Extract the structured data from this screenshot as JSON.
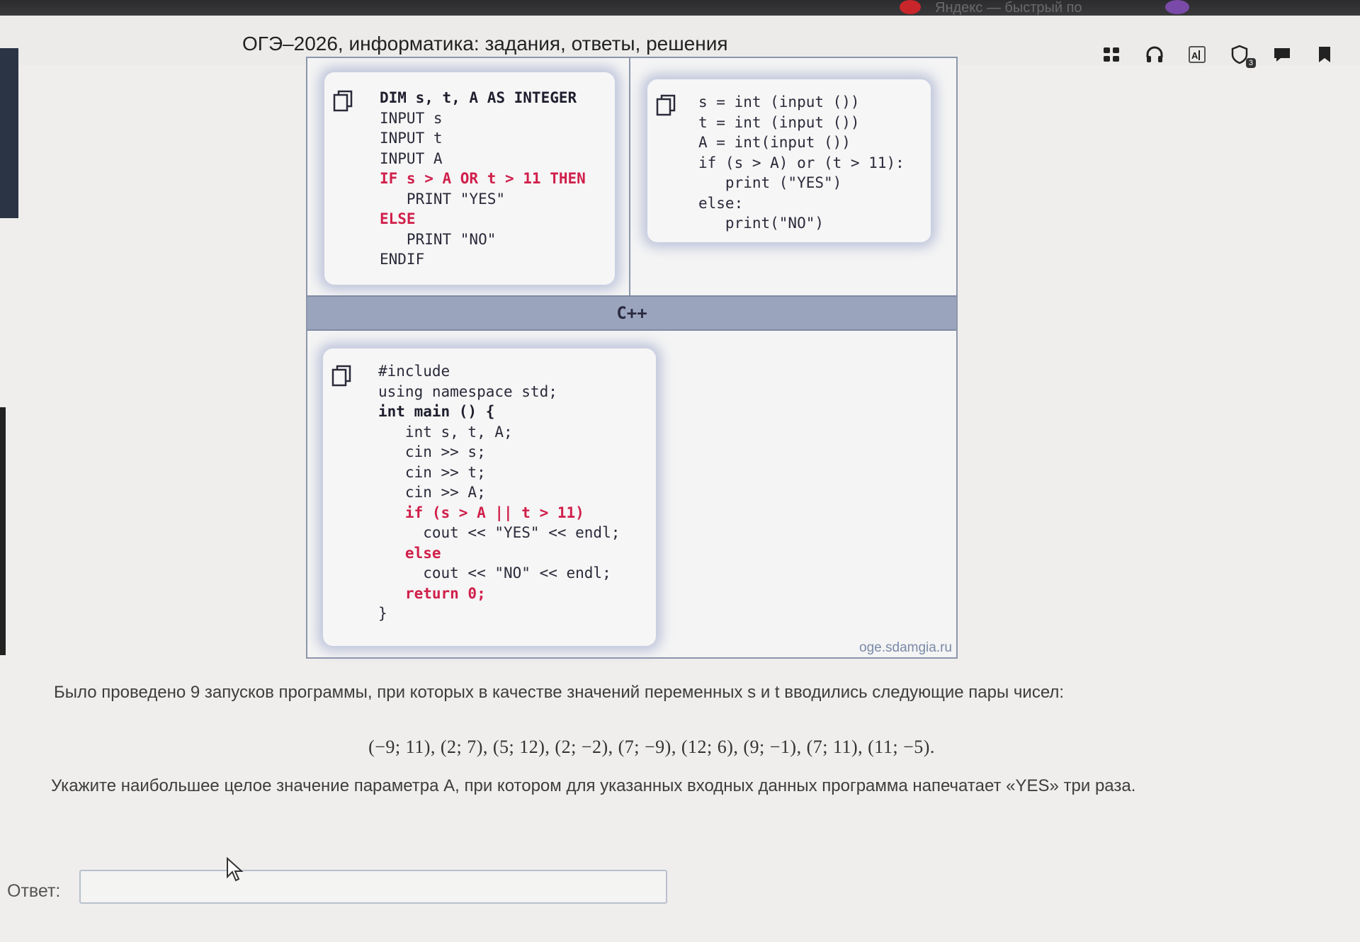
{
  "browser": {
    "tab_text": "Яндекс — быстрый по"
  },
  "header": {
    "title": "ОГЭ–2026, информатика: задания, ответы, решения",
    "toolbar": [
      {
        "icon": "apps-grid-icon"
      },
      {
        "icon": "headphones-icon"
      },
      {
        "icon": "translate-icon"
      },
      {
        "icon": "shield-icon",
        "badge": "3"
      },
      {
        "icon": "comments-icon"
      },
      {
        "icon": "bookmark-icon"
      }
    ]
  },
  "code": {
    "basic": [
      "DIM s, t, A AS INTEGER",
      "INPUT s",
      "INPUT t",
      "INPUT A",
      "IF s > A OR t > 11 THEN",
      "   PRINT \"YES\"",
      "ELSE",
      "   PRINT \"NO\"",
      "ENDIF"
    ],
    "python": [
      "s = int (input ())",
      "t = int (input ())",
      "A = int(input ())",
      "if (s > A) or (t > 11):",
      "   print (\"YES\")",
      "else:",
      "   print(\"NO\")"
    ],
    "cpp_label": "C++",
    "cpp": [
      "#include",
      "using namespace std;",
      "int main () {",
      "   int s, t, A;",
      "   cin >> s;",
      "   cin >> t;",
      "   cin >> A;",
      "   if (s > A || t > 11)",
      "     cout << \"YES\" << endl;",
      "   else",
      "     cout << \"NO\" << endl;",
      "   return 0;",
      "}"
    ],
    "watermark": "oge.sdamgia.ru"
  },
  "task": {
    "intro": "Было проведено 9 запусков программы, при которых в качестве значений переменных s и t вводились следующие пары чисел:",
    "pairs": "(−9; 11), (2; 7), (5; 12), (2; −2), (7; −9), (12; 6), (9; −1), (7; 11), (11; −5).",
    "question": "Укажите наибольшее целое значение параметра A, при котором для указанных входных данных программа напечатает «YES» три раза."
  },
  "answer": {
    "label": "Ответ:",
    "value": "",
    "placeholder": ""
  }
}
